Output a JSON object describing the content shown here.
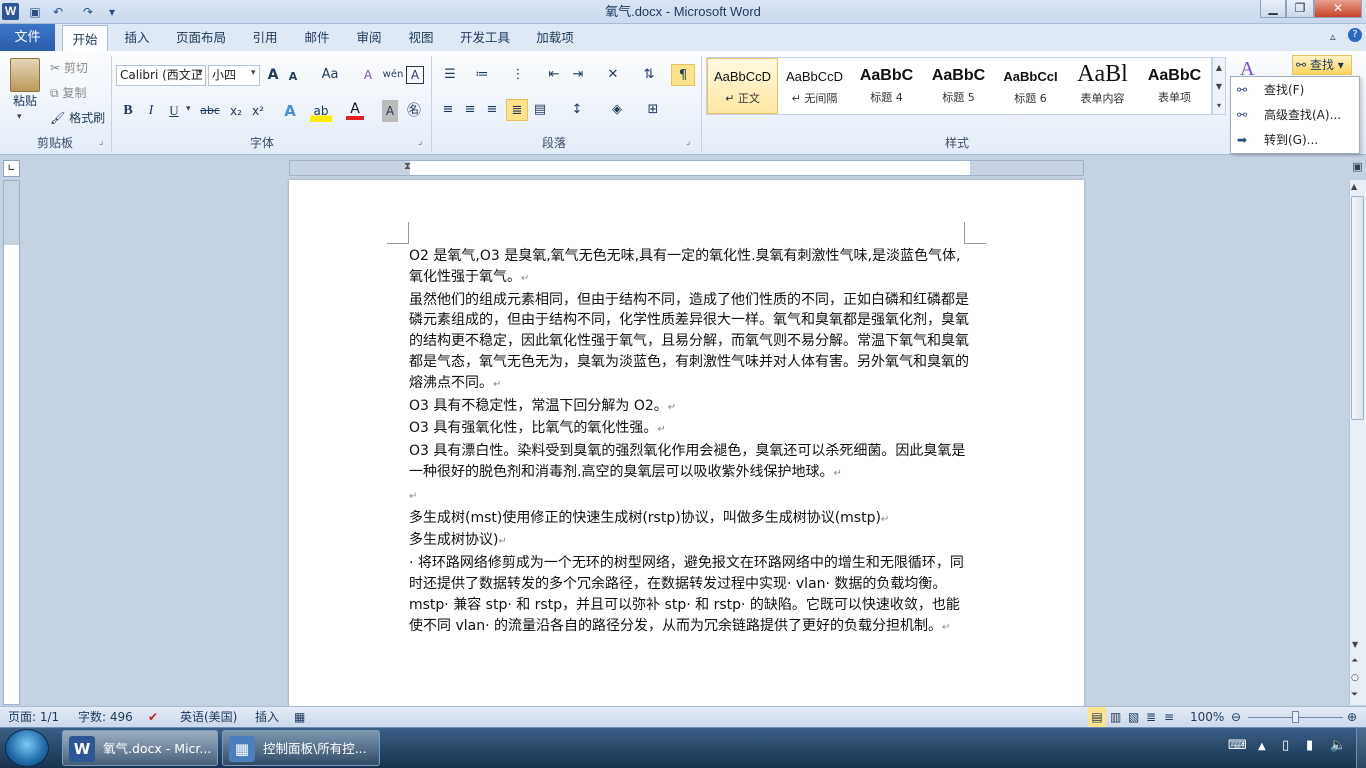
{
  "window": {
    "title": "氧气.docx - Microsoft Word"
  },
  "quick_access": {
    "save_icon": "save-icon",
    "undo_icon": "undo-icon",
    "redo_icon": "redo-icon"
  },
  "tabs": {
    "file": "文件",
    "items": [
      "开始",
      "插入",
      "页面布局",
      "引用",
      "邮件",
      "审阅",
      "视图",
      "开发工具",
      "加载项"
    ],
    "active": "开始"
  },
  "clipboard": {
    "paste": "粘贴",
    "cut": "剪切",
    "copy": "复制",
    "format_painter": "格式刷",
    "group": "剪贴板"
  },
  "font": {
    "name": "Calibri (西文正",
    "size": "小四",
    "group": "字体",
    "bold": "B",
    "italic": "I",
    "underline": "U",
    "strike": "abc",
    "sub": "x₂",
    "sup": "x²",
    "grow": "A",
    "shrink": "A",
    "case": "Aa",
    "clear": "A",
    "pinyin": "wén"
  },
  "paragraph": {
    "group": "段落"
  },
  "styles": {
    "group": "样式",
    "items": [
      {
        "preview": "AaBbCcD",
        "name": "↵ 正文"
      },
      {
        "preview": "AaBbCcD",
        "name": "↵ 无间隔"
      },
      {
        "preview": "AaBbC",
        "name": "标题 4"
      },
      {
        "preview": "AaBbC",
        "name": "标题 5"
      },
      {
        "preview": "AaBbCcI",
        "name": "标题 6"
      },
      {
        "preview": "AaBl",
        "name": "表单内容"
      },
      {
        "preview": "AaBbC",
        "name": "表单项"
      }
    ]
  },
  "editing": {
    "find": "查找",
    "menu": [
      "查找(F)",
      "高级查找(A)...",
      "转到(G)..."
    ]
  },
  "document": {
    "paragraphs": [
      "O2 是氧气,O3 是臭氧,氧气无色无味,具有一定的氧化性.臭氧有刺激性气味,是淡蓝色气体,氧化性强于氧气。",
      "虽然他们的组成元素相同，但由于结构不同，造成了他们性质的不同，正如白磷和红磷都是磷元素组成的，但由于结构不同，化学性质差异很大一样。氧气和臭氧都是强氧化剂，臭氧的结构更不稳定，因此氧化性强于氧气，且易分解，而氧气则不易分解。常温下氧气和臭氧都是气态，氧气无色无为，臭氧为淡蓝色，有刺激性气味并对人体有害。另外氧气和臭氧的熔沸点不同。",
      "O3 具有不稳定性，常温下回分解为 O2。",
      "O3 具有强氧化性，比氧气的氧化性强。",
      "O3 具有漂白性。染料受到臭氧的强烈氧化作用会褪色，臭氧还可以杀死细菌。因此臭氧是一种很好的脱色剂和消毒剂.高空的臭氧层可以吸收紫外线保护地球。",
      "",
      "多生成树(mst)使用修正的快速生成树(rstp)协议，叫做多生成树协议(mstp)",
      "多生成树协议)",
      "· 将环路网络修剪成为一个无环的树型网络，避免报文在环路网络中的增生和无限循环，同时还提供了数据转发的多个冗余路径，在数据转发过程中实现· vlan· 数据的负载均衡。mstp· 兼容 stp· 和 rstp，并且可以弥补 stp· 和 rstp· 的缺陷。它既可以快速收敛，也能使不同 vlan· 的流量沿各自的路径分发，从而为冗余链路提供了更好的负载分担机制。"
    ]
  },
  "status": {
    "page": "页面: 1/1",
    "words": "字数: 496",
    "language": "英语(美国)",
    "mode": "插入",
    "zoom": "100%"
  },
  "taskbar": {
    "items": [
      "氧气.docx - Micr...",
      "控制面板\\所有控..."
    ]
  }
}
